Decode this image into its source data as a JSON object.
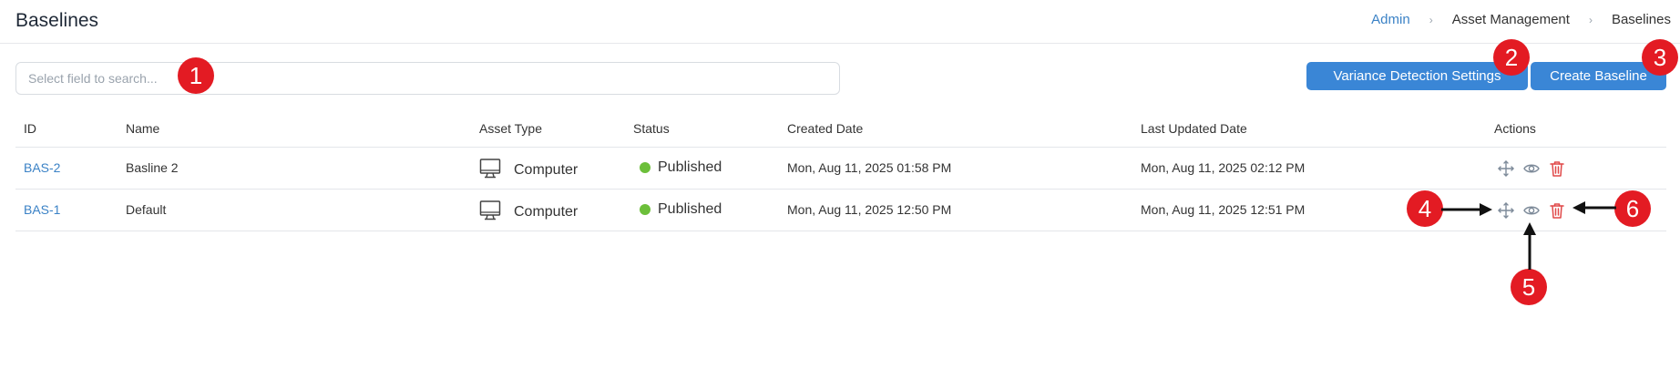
{
  "header": {
    "title": "Baselines",
    "breadcrumb": [
      {
        "label": "Admin"
      },
      {
        "label": "Asset Management"
      },
      {
        "label": "Baselines"
      }
    ],
    "separator": "›"
  },
  "search": {
    "placeholder": "Select field to search..."
  },
  "buttons": {
    "variance": "Variance Detection Settings",
    "create": "Create Baseline"
  },
  "table": {
    "columns": {
      "id": "ID",
      "name": "Name",
      "asset_type": "Asset Type",
      "status": "Status",
      "created": "Created Date",
      "updated": "Last Updated Date",
      "actions": "Actions"
    },
    "rows": [
      {
        "id": "BAS-2",
        "name": "Basline 2",
        "asset_type": "Computer",
        "status": "Published",
        "created": "Mon, Aug 11, 2025 01:58 PM",
        "updated": "Mon, Aug 11, 2025 02:12 PM"
      },
      {
        "id": "BAS-1",
        "name": "Default",
        "asset_type": "Computer",
        "status": "Published",
        "created": "Mon, Aug 11, 2025 12:50 PM",
        "updated": "Mon, Aug 11, 2025 12:51 PM"
      }
    ],
    "action_icons": [
      "move-icon",
      "eye-icon",
      "trash-icon"
    ]
  },
  "annotations": {
    "markers": [
      "1",
      "2",
      "3",
      "4",
      "5",
      "6"
    ]
  },
  "colors": {
    "accent": "#3a86d6",
    "link": "#3b82c6",
    "published": "#6cbf3a",
    "delete": "#e04848",
    "marker": "#e31b23"
  }
}
